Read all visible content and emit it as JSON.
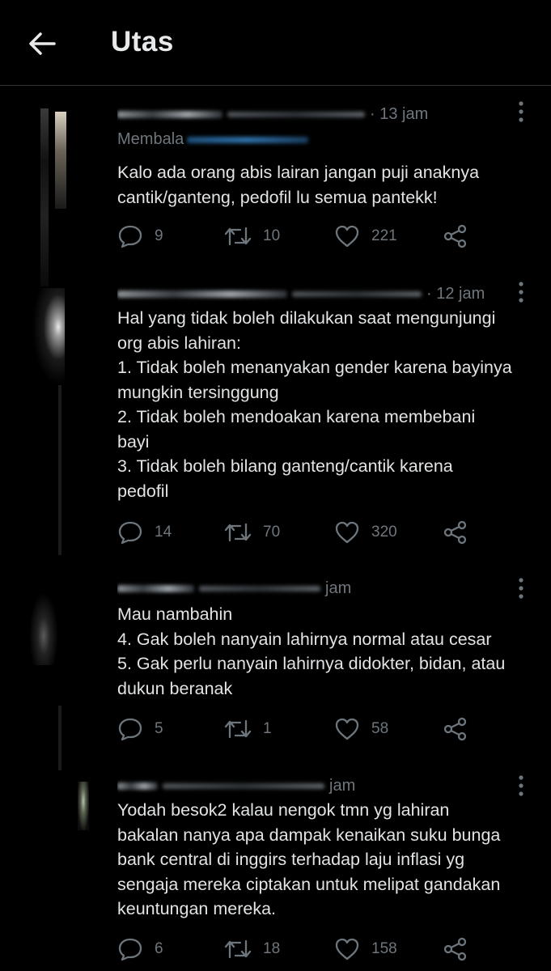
{
  "header": {
    "back_label": "Back",
    "title": "Utas"
  },
  "tweets": [
    {
      "time": "· 13 jam",
      "replying_to": "Membala",
      "text": "Kalo ada orang abis lairan jangan puji anaknya\ncantik/ganteng, pedofil lu semua pantekk!",
      "replies": "9",
      "retweets": "10",
      "likes": "221"
    },
    {
      "time": "· 12 jam",
      "text": "Hal yang tidak boleh dilakukan saat mengunjungi\norg abis lahiran:\n1. Tidak boleh menanyakan gender karena bayinya\nmungkin tersinggung\n2. Tidak boleh mendoakan karena membebani\nbayi\n3. Tidak boleh bilang ganteng/cantik karena\npedofil",
      "replies": "14",
      "retweets": "70",
      "likes": "320"
    },
    {
      "time": "jam",
      "text": "Mau nambahin\n4. Gak boleh nanyain lahirnya normal atau cesar\n5. Gak perlu nanyain lahirnya didokter, bidan, atau\ndukun beranak",
      "replies": "5",
      "retweets": "1",
      "likes": "58"
    },
    {
      "time": "jam",
      "text": "Yodah besok2 kalau nengok tmn yg lahiran\nbakalan nanya apa dampak kenaikan suku bunga\nbank central di inggirs terhadap laju inflasi yg\nsengaja mereka ciptakan untuk melipat gandakan\nkeuntungan mereka.",
      "replies": "6",
      "retweets": "18",
      "likes": "158"
    }
  ],
  "colors": {
    "background": "#000000",
    "divider": "#2f3336",
    "text_primary": "#e1e3e5",
    "text_secondary": "#6e767d",
    "icon": "#6e767d"
  },
  "icons": {
    "back": "arrow-left-icon",
    "more": "kebab-vertical-icon",
    "reply": "speech-bubble-icon",
    "retweet": "retweet-icon",
    "like": "heart-icon",
    "share": "share-icon"
  }
}
